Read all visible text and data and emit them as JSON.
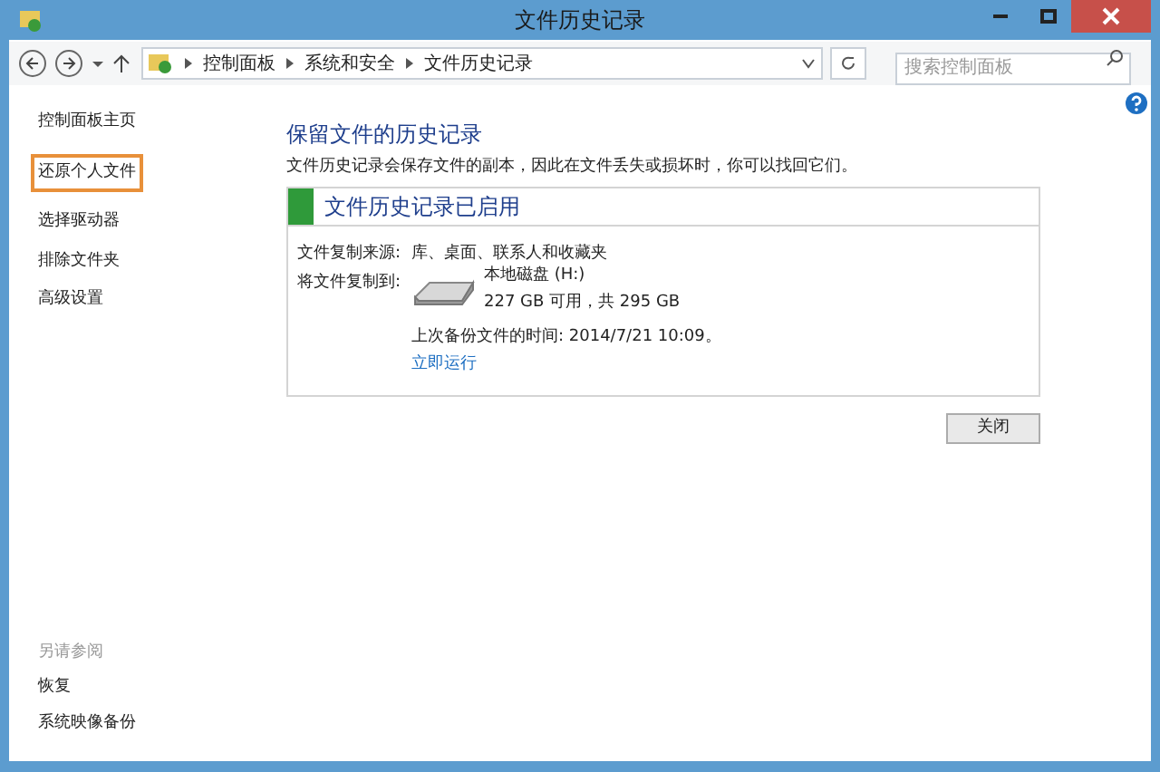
{
  "window": {
    "title": "文件历史记录"
  },
  "address_bar": {
    "breadcrumbs": [
      "控制面板",
      "系统和安全",
      "文件历史记录"
    ]
  },
  "search": {
    "placeholder": "搜索控制面板"
  },
  "sidebar": {
    "items": [
      {
        "label": "控制面板主页",
        "highlighted": false
      },
      {
        "label": "还原个人文件",
        "highlighted": true
      },
      {
        "label": "选择驱动器",
        "highlighted": false
      },
      {
        "label": "排除文件夹",
        "highlighted": false
      },
      {
        "label": "高级设置",
        "highlighted": false
      }
    ],
    "see_also": {
      "heading": "另请参阅",
      "items": [
        "恢复",
        "系统映像备份"
      ]
    }
  },
  "main": {
    "heading": "保留文件的历史记录",
    "description": "文件历史记录会保存文件的副本，因此在文件丢失或损坏时，你可以找回它们。",
    "panel": {
      "status": "文件历史记录已启用",
      "enabled": true,
      "source_label": "文件复制来源:",
      "source_value": "库、桌面、联系人和收藏夹",
      "target_label": "将文件复制到:",
      "drive_name": "本地磁盘 (H:)",
      "drive_space": "227 GB 可用，共 295 GB",
      "last_backup": "上次备份文件的时间: 2014/7/21 10:09。",
      "run_now": "立即运行"
    },
    "close_button": "关闭"
  }
}
